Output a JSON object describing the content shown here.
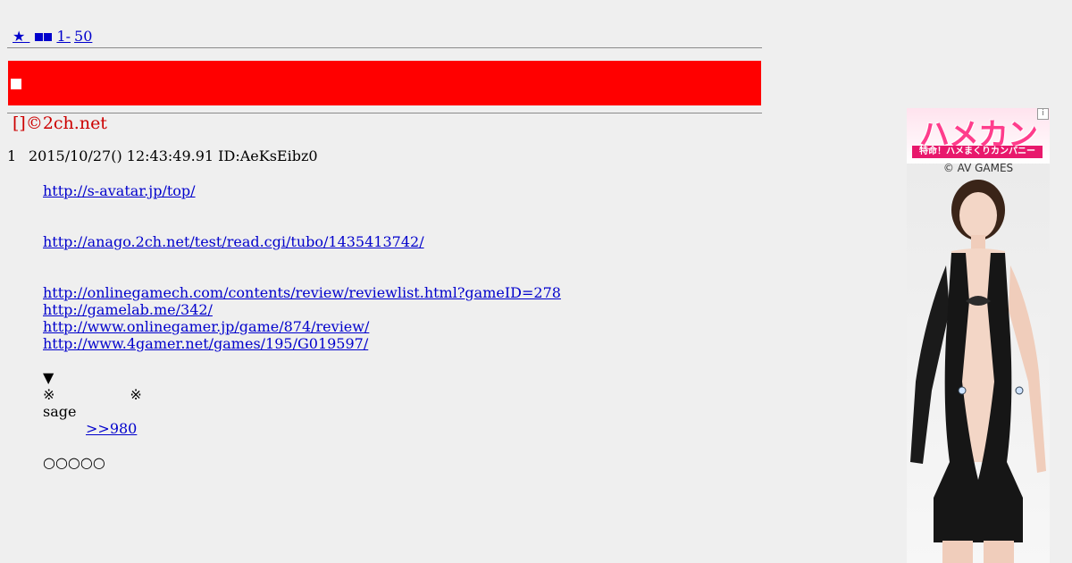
{
  "nav": {
    "link1": "  ",
    "link2": "★ ",
    "link3_glyph": "◆",
    "link4": "1-",
    "link5": "50"
  },
  "thread": {
    "title": "[]©2ch.net"
  },
  "post": {
    "number": "1",
    "header": "2015/10/27() 12:43:49.91 ID:AeKsEibz0",
    "links": [
      "http://s-avatar.jp/top/",
      "http://anago.2ch.net/test/read.cgi/tubo/1435413742/",
      "http://onlinegamech.com/contents/review/reviewlist.html?gameID=278",
      "http://gamelab.me/342/",
      "http://www.onlinegamer.jp/game/874/review/",
      "http://www.4gamer.net/games/195/G019597/"
    ],
    "triangle": "▼",
    "mark_left": "※",
    "mark_right": "※",
    "sage": "sage",
    "reply_link": ">>980",
    "circles": "○○○○○"
  },
  "ad": {
    "logo": "ハメカン",
    "subtitle": "特命！ハメまくりカンパニー",
    "copyright": "© AV GAMES",
    "info_icon": "i",
    "colors": {
      "brand_pink": "#ff3d8c",
      "banner_red": "#ff0000"
    }
  }
}
